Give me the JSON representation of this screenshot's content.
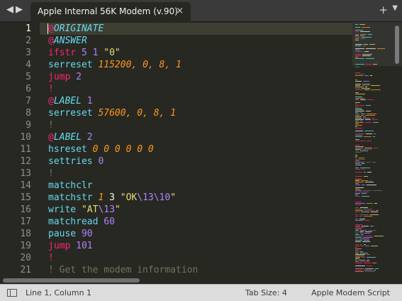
{
  "tabbar": {
    "back_icon": "◀",
    "forward_icon": "▶",
    "tab_title": "Apple Internal 56K Modem (v.90)",
    "close_icon": "×",
    "plus_icon": "+",
    "menu_icon": "▼"
  },
  "editor": {
    "line_numbers": [
      "1",
      "2",
      "3",
      "4",
      "5",
      "6",
      "7",
      "8",
      "9",
      "10",
      "11",
      "12",
      "13",
      "14",
      "15",
      "16",
      "17",
      "18",
      "19",
      "20",
      "21"
    ],
    "active_line": 1,
    "lines": [
      [
        {
          "t": "@",
          "c": "kw"
        },
        {
          "t": "ORIGINATE",
          "c": "dir"
        }
      ],
      [
        {
          "t": "@",
          "c": "kw"
        },
        {
          "t": "ANSWER",
          "c": "dir"
        }
      ],
      [
        {
          "t": "ifstr",
          "c": "kw"
        },
        {
          "t": " "
        },
        {
          "t": "5",
          "c": "num"
        },
        {
          "t": " "
        },
        {
          "t": "1",
          "c": "num"
        },
        {
          "t": " "
        },
        {
          "t": "\"0\"",
          "c": "str"
        }
      ],
      [
        {
          "t": "serreset",
          "c": "fn"
        },
        {
          "t": " "
        },
        {
          "t": "115200, 0, 8, 1",
          "c": "arg"
        }
      ],
      [
        {
          "t": "jump",
          "c": "kw"
        },
        {
          "t": " "
        },
        {
          "t": "2",
          "c": "num"
        }
      ],
      [
        {
          "t": "!",
          "c": "kw"
        }
      ],
      [
        {
          "t": "@",
          "c": "kw"
        },
        {
          "t": "LABEL",
          "c": "dir"
        },
        {
          "t": " "
        },
        {
          "t": "1",
          "c": "num"
        }
      ],
      [
        {
          "t": "serreset",
          "c": "fn"
        },
        {
          "t": " "
        },
        {
          "t": "57600, 0, 8, 1",
          "c": "arg"
        }
      ],
      [
        {
          "t": "!",
          "c": "comment"
        }
      ],
      [
        {
          "t": "@",
          "c": "kw"
        },
        {
          "t": "LABEL",
          "c": "dir"
        },
        {
          "t": " "
        },
        {
          "t": "2",
          "c": "num"
        }
      ],
      [
        {
          "t": "hsreset",
          "c": "fn"
        },
        {
          "t": " "
        },
        {
          "t": "0 0 0 0 0 0",
          "c": "arg"
        }
      ],
      [
        {
          "t": "settries",
          "c": "fn"
        },
        {
          "t": " "
        },
        {
          "t": "0",
          "c": "num"
        }
      ],
      [
        {
          "t": "!",
          "c": "comment"
        }
      ],
      [
        {
          "t": "matchclr",
          "c": "fn"
        }
      ],
      [
        {
          "t": "matchstr",
          "c": "fn"
        },
        {
          "t": " "
        },
        {
          "t": "1",
          "c": "arg"
        },
        {
          "t": " 3 "
        },
        {
          "t": "\"OK",
          "c": "str"
        },
        {
          "t": "\\13\\10",
          "c": "esc"
        },
        {
          "t": "\"",
          "c": "str"
        }
      ],
      [
        {
          "t": "write",
          "c": "fn"
        },
        {
          "t": " "
        },
        {
          "t": "\"AT",
          "c": "str"
        },
        {
          "t": "\\13",
          "c": "esc"
        },
        {
          "t": "\"",
          "c": "str"
        }
      ],
      [
        {
          "t": "matchread",
          "c": "fn"
        },
        {
          "t": " "
        },
        {
          "t": "60",
          "c": "num"
        }
      ],
      [
        {
          "t": "pause",
          "c": "fn"
        },
        {
          "t": " "
        },
        {
          "t": "90",
          "c": "num"
        }
      ],
      [
        {
          "t": "jump",
          "c": "kw"
        },
        {
          "t": " "
        },
        {
          "t": "101",
          "c": "num"
        }
      ],
      [
        {
          "t": "!",
          "c": "kw"
        }
      ],
      [
        {
          "t": "! Get the modem information",
          "c": "comment"
        }
      ]
    ]
  },
  "statusbar": {
    "position": "Line 1, Column 1",
    "tab_size": "Tab Size: 4",
    "syntax": "Apple Modem Script"
  },
  "colors": {
    "background": "#272822",
    "keyword": "#f92672",
    "function": "#66d9ef",
    "number": "#ae81ff",
    "string": "#e6db74",
    "argument": "#fd971f",
    "comment": "#75715e"
  }
}
